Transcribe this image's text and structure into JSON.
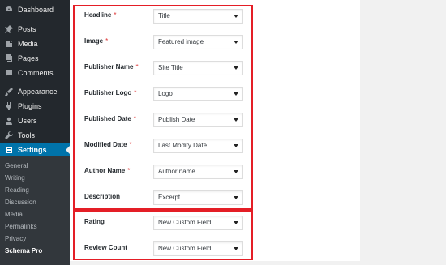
{
  "sidebar": {
    "items": [
      {
        "label": "Dashboard",
        "icon": "dashboard-icon"
      },
      {
        "label": "Posts",
        "icon": "pin-icon"
      },
      {
        "label": "Media",
        "icon": "media-icon"
      },
      {
        "label": "Pages",
        "icon": "pages-icon"
      },
      {
        "label": "Comments",
        "icon": "comments-icon"
      },
      {
        "label": "Appearance",
        "icon": "brush-icon"
      },
      {
        "label": "Plugins",
        "icon": "plugin-icon"
      },
      {
        "label": "Users",
        "icon": "user-icon"
      },
      {
        "label": "Tools",
        "icon": "wrench-icon"
      },
      {
        "label": "Settings",
        "icon": "settings-icon",
        "active": true
      }
    ],
    "submenu": [
      "General",
      "Writing",
      "Reading",
      "Discussion",
      "Media",
      "Permalinks",
      "Privacy",
      "Schema Pro"
    ],
    "current_submenu": "Schema Pro",
    "colors": {
      "background": "#23282d",
      "active": "#0073aa",
      "submenu_bg": "#32373c"
    }
  },
  "fields": [
    {
      "label": "Headline",
      "required": true,
      "value": "Title"
    },
    {
      "label": "Image",
      "required": true,
      "value": "Featured image"
    },
    {
      "label": "Publisher Name",
      "required": true,
      "value": "Site Title"
    },
    {
      "label": "Publisher Logo",
      "required": true,
      "value": "Logo"
    },
    {
      "label": "Published Date",
      "required": true,
      "value": "Publish Date"
    },
    {
      "label": "Modified Date",
      "required": true,
      "value": "Last Modify Date"
    },
    {
      "label": "Author Name",
      "required": true,
      "value": "Author name"
    },
    {
      "label": "Description",
      "required": false,
      "value": "Excerpt"
    },
    {
      "label": "Rating",
      "required": false,
      "value": "New Custom Field"
    },
    {
      "label": "Review Count",
      "required": false,
      "value": "New Custom Field"
    }
  ],
  "required_marker": "*",
  "highlight_color": "#e41e26"
}
